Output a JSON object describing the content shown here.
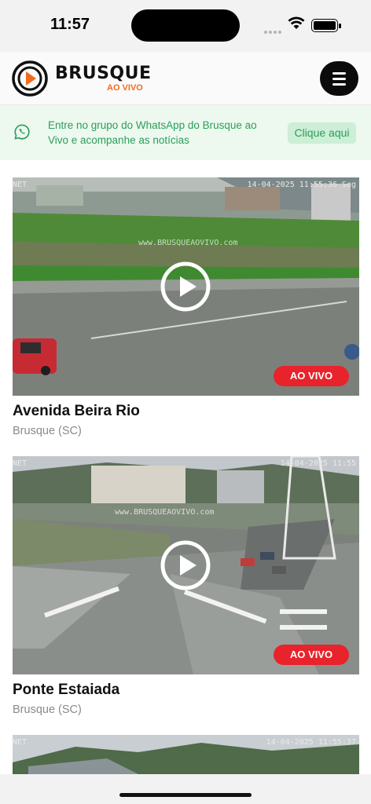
{
  "status_bar": {
    "time": "11:57"
  },
  "header": {
    "logo_title": "BRUSQUE",
    "logo_subtitle": "AO VIVO"
  },
  "whatsapp_banner": {
    "text": "Entre no grupo do WhatsApp do Brusque ao Vivo e acompanhe as notícias",
    "button_label": "Clique aqui"
  },
  "cameras": [
    {
      "title": "Avenida Beira Rio",
      "location": "Brusque (SC)",
      "badge": "AO VIVO",
      "overlay_timestamp": "14-04-2025 11:55:36 Seg",
      "overlay_net": "NET",
      "overlay_watermark": "www.BRUSQUEAOVIVO.com"
    },
    {
      "title": "Ponte Estaiada",
      "location": "Brusque (SC)",
      "badge": "AO VIVO",
      "overlay_timestamp": "14-04-2025 11:55",
      "overlay_net": "NET",
      "overlay_watermark": "www.BRUSQUEAOVIVO.com"
    },
    {
      "overlay_timestamp": "14-04-2025 11:55:37",
      "overlay_net": "NET"
    }
  ],
  "colors": {
    "brand_orange": "#f36b1c",
    "live_red": "#e8232b",
    "whatsapp_green": "#2c9e58",
    "banner_bg": "#edf8ef"
  }
}
